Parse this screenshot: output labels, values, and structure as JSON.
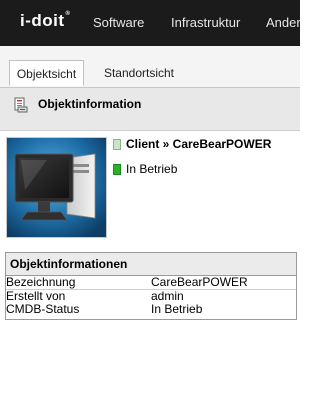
{
  "nav": {
    "logo": "i-doit",
    "logo_mark": "®",
    "items": [
      "Software",
      "Infrastruktur",
      "Anderes"
    ]
  },
  "tabs": [
    {
      "label": "Objektsicht",
      "active": true
    },
    {
      "label": "Standortsicht",
      "active": false
    }
  ],
  "header": {
    "icon": "object-info-icon",
    "title": "Objektinformation"
  },
  "object": {
    "thumbnail": "client-computer-icon",
    "title": "Client » CareBearPOWER",
    "status": "In Betrieb",
    "status_color": "#2ab12a"
  },
  "info_table": {
    "title": "Objektinformationen",
    "rows": [
      {
        "label": "Bezeichnung",
        "value": "CareBearPOWER"
      },
      {
        "label": "Erstellt von",
        "value": "admin"
      },
      {
        "label": "CMDB-Status",
        "value": "In Betrieb"
      }
    ]
  }
}
